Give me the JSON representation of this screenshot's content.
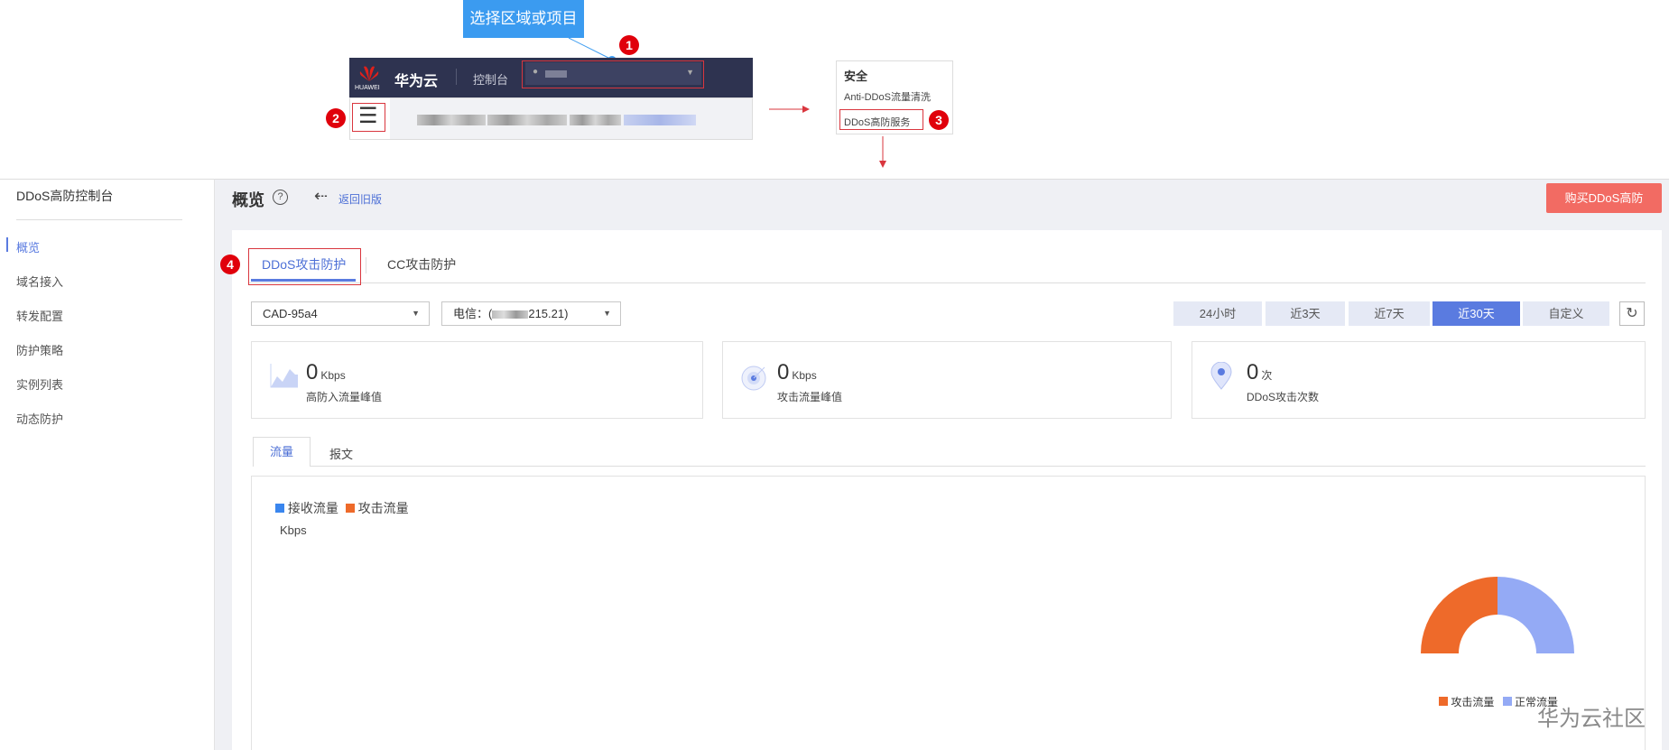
{
  "annotation": {
    "tooltip": "选择区域或项目",
    "markers": [
      "1",
      "2",
      "3",
      "4"
    ]
  },
  "console_header": {
    "brand": "华为云",
    "logo_text": "HUAWEI",
    "console_label": "控制台"
  },
  "service_menu": {
    "category": "安全",
    "items": [
      "Anti-DDoS流量清洗",
      "DDoS高防服务"
    ]
  },
  "sidebar": {
    "title": "DDoS高防控制台",
    "items": [
      "概览",
      "域名接入",
      "转发配置",
      "防护策略",
      "实例列表",
      "动态防护"
    ],
    "active": 0
  },
  "page_header": {
    "title": "概览",
    "back_link": "返回旧版",
    "buy_button": "购买DDoS高防"
  },
  "tabs": {
    "items": [
      "DDoS攻击防护",
      "CC攻击防护"
    ],
    "active": 0
  },
  "filters": {
    "instance": "CAD-95a4",
    "line_prefix": "电信：(",
    "line_suffix": "215.21)"
  },
  "time_range": {
    "options": [
      "24小时",
      "近3天",
      "近7天",
      "近30天",
      "自定义"
    ],
    "active": 3
  },
  "stats": [
    {
      "value": "0",
      "unit": "Kbps",
      "label": "高防入流量峰值"
    },
    {
      "value": "0",
      "unit": "Kbps",
      "label": "攻击流量峰值"
    },
    {
      "value": "0",
      "unit": "次",
      "label": "DDoS攻击次数"
    }
  ],
  "sub_tabs": {
    "items": [
      "流量",
      "报文"
    ],
    "active": 0
  },
  "chart_data": [
    {
      "type": "line",
      "legend": [
        "接收流量",
        "攻击流量"
      ],
      "colors": [
        "#3a86ee",
        "#ee6a2a"
      ],
      "ylabel": "Kbps",
      "series": []
    },
    {
      "type": "pie",
      "style": "half-donut",
      "categories": [
        "攻击流量",
        "正常流量"
      ],
      "values": [
        50,
        50
      ],
      "colors": [
        "#ee6a2a",
        "#94aaf5"
      ],
      "legend": "bottom"
    }
  ],
  "watermark": "华为云社区"
}
